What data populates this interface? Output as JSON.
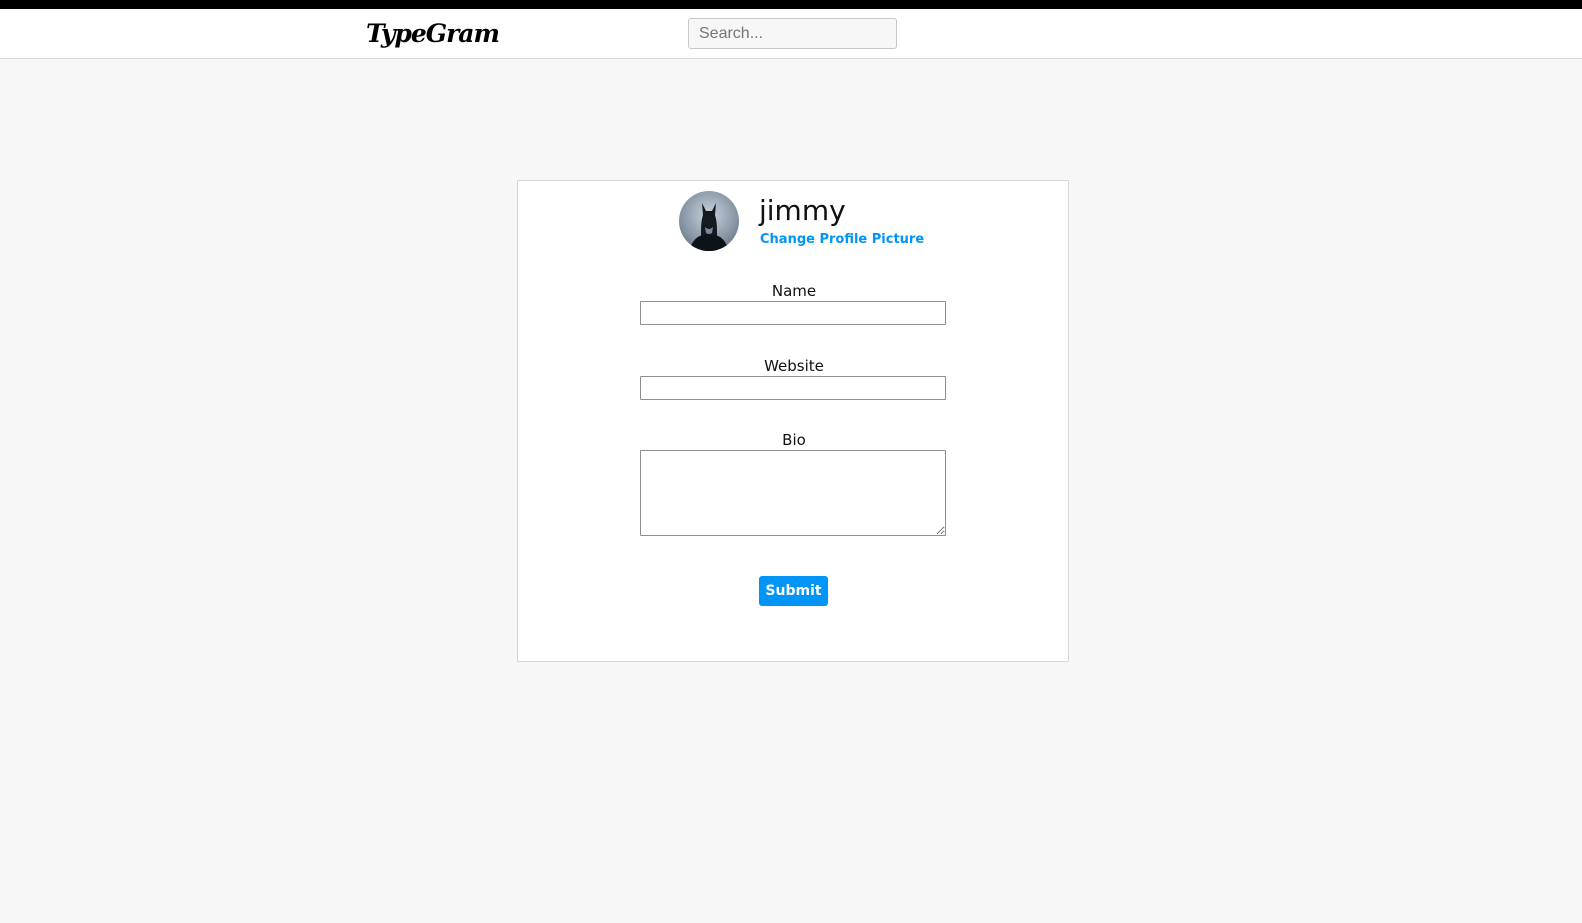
{
  "header": {
    "logo": "TypeGram",
    "search_placeholder": "Search..."
  },
  "profile": {
    "username": "jimmy",
    "change_picture_label": "Change Profile Picture",
    "avatar_icon": "batman-avatar"
  },
  "form": {
    "name_label": "Name",
    "name_value": "",
    "website_label": "Website",
    "website_value": "",
    "bio_label": "Bio",
    "bio_value": "",
    "submit_label": "Submit"
  },
  "colors": {
    "accent": "#0095f6",
    "background": "#f7f7f7",
    "card": "#ffffff",
    "top_stripe": "#000000"
  }
}
